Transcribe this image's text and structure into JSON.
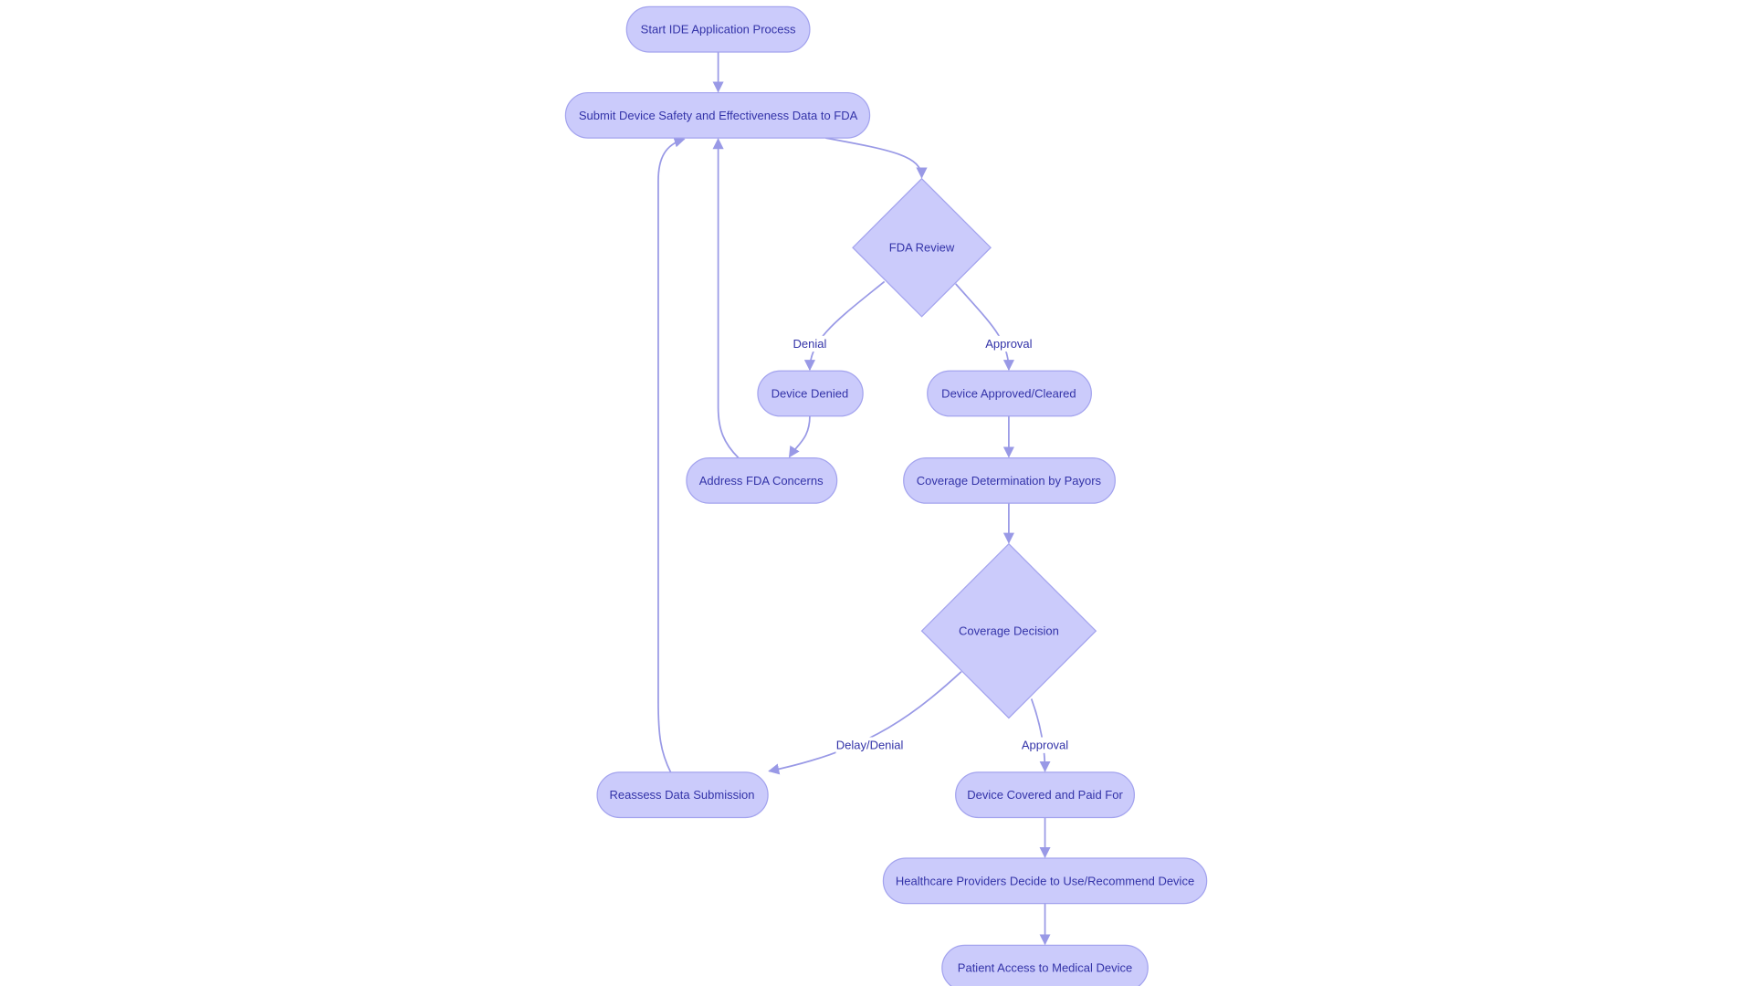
{
  "colors": {
    "node_fill": "#cbcbfb",
    "node_stroke": "#a3a3ee",
    "edge": "#9999e6",
    "text": "#3333a8",
    "background": "#ffffff"
  },
  "nodes": {
    "start": "Start IDE Application Process",
    "submit": "Submit Device Safety and Effectiveness Data to FDA",
    "fda_review": "FDA Review",
    "denied": "Device Denied",
    "approved": "Device Approved/Cleared",
    "address": "Address FDA Concerns",
    "coverage_det": "Coverage Determination by Payors",
    "coverage_dec": "Coverage Decision",
    "reassess": "Reassess Data Submission",
    "covered": "Device Covered and Paid For",
    "providers": "Healthcare Providers Decide to Use/Recommend Device",
    "patient": "Patient Access to Medical Device"
  },
  "edge_labels": {
    "fda_denial": "Denial",
    "fda_approval": "Approval",
    "cov_delay": "Delay/Denial",
    "cov_approval": "Approval"
  }
}
